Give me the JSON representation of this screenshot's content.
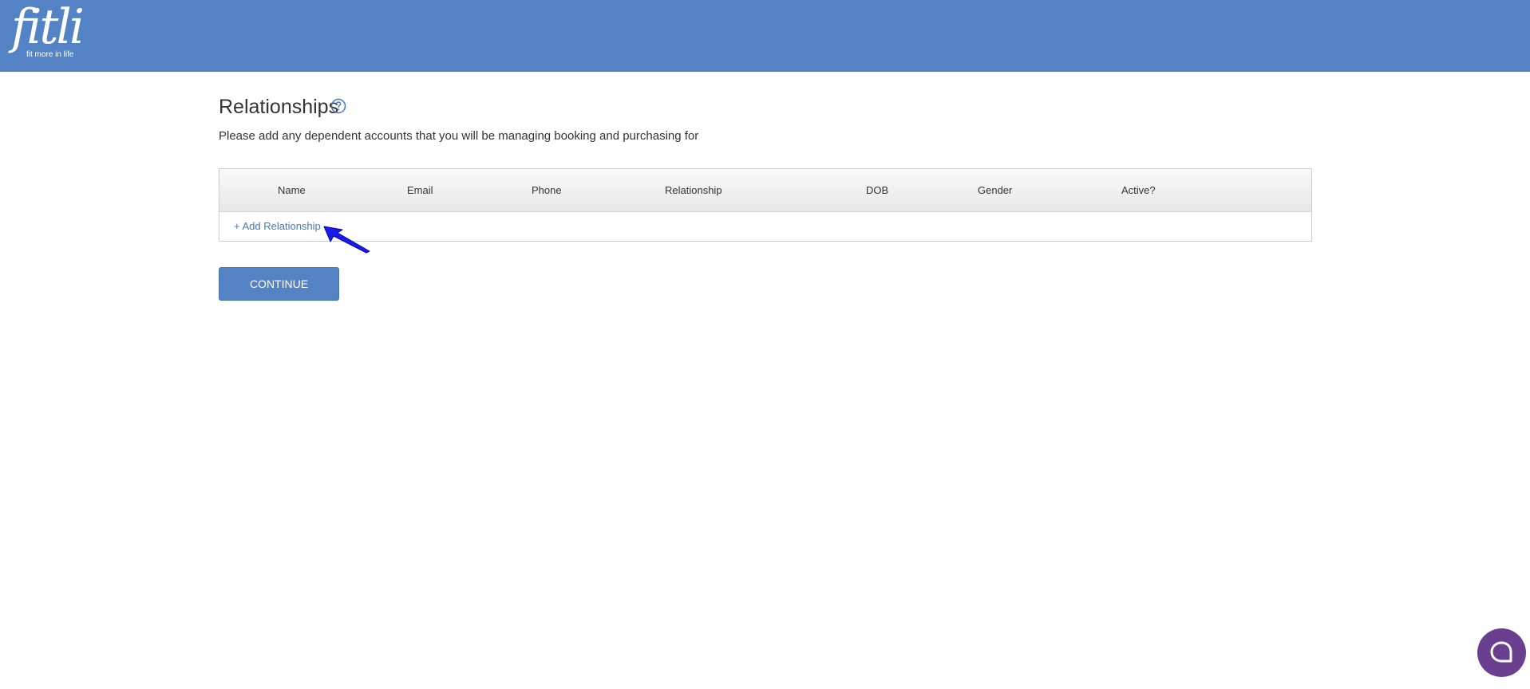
{
  "header": {
    "logo_text": "fitli",
    "logo_tagline": "fit more in life"
  },
  "page": {
    "title": "Relationships",
    "help_icon": "help-circle-icon",
    "subtitle": "Please add any dependent accounts that you will be managing booking and purchasing for"
  },
  "table": {
    "columns": [
      "Name",
      "Email",
      "Phone",
      "Relationship",
      "DOB",
      "Gender",
      "Active?"
    ],
    "add_link": "+ Add Relationship"
  },
  "actions": {
    "continue_label": "CONTINUE"
  },
  "chat": {
    "icon": "chat-bubble-icon"
  },
  "colors": {
    "header_bg": "#5383c4",
    "link": "#4a78b8",
    "chat_bg": "#6a3f8f"
  }
}
